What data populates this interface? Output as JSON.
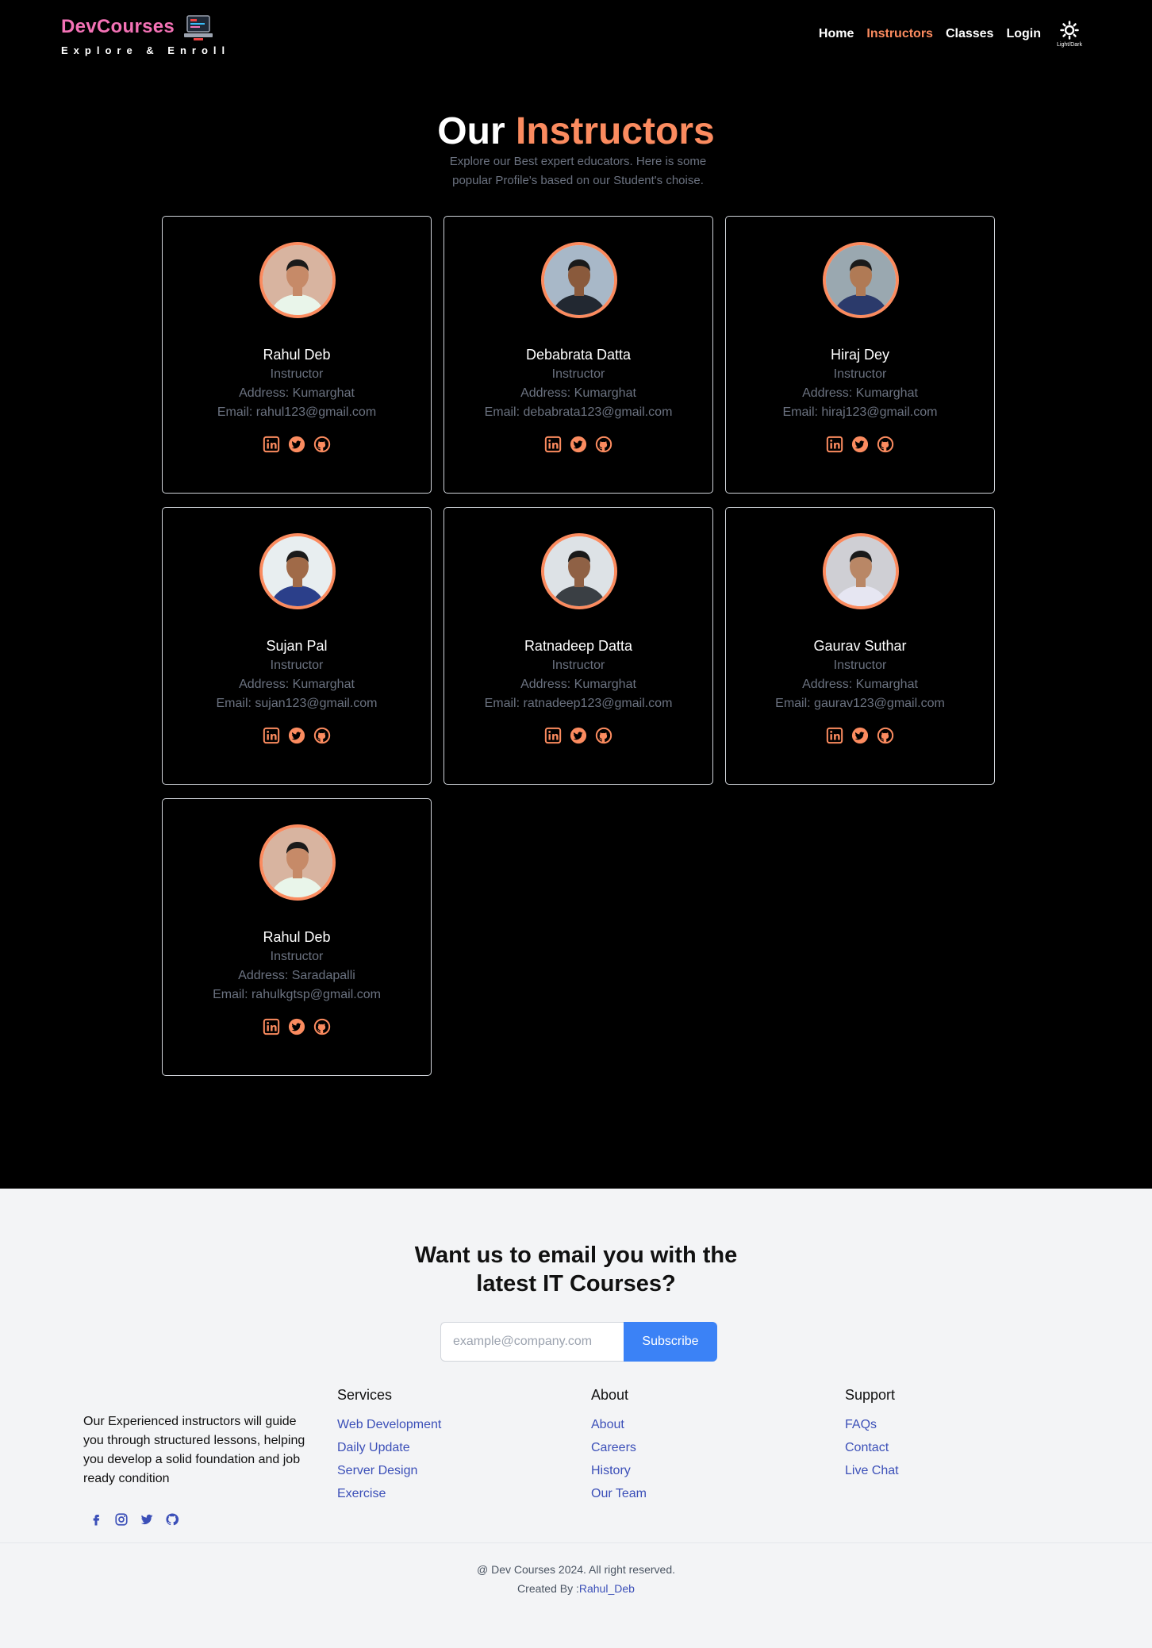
{
  "header": {
    "brand_name": "DevCourses",
    "brand_tagline": "Explore & Enroll",
    "nav": [
      {
        "label": "Home",
        "active": false
      },
      {
        "label": "Instructors",
        "active": true
      },
      {
        "label": "Classes",
        "active": false
      },
      {
        "label": "Login",
        "active": false
      }
    ],
    "theme_toggle_label": "Light/Dark"
  },
  "hero": {
    "title_prefix": "Our",
    "title_accent": "Instructors",
    "subtitle": "Explore our Best expert educators. Here is some popular Profile's based on our Student's choise."
  },
  "instructors": [
    {
      "name": "Rahul Deb",
      "role": "Instructor",
      "address": "Address: Kumarghat",
      "email": "Email: rahul123@gmail.com"
    },
    {
      "name": "Debabrata Datta",
      "role": "Instructor",
      "address": "Address: Kumarghat",
      "email": "Email: debabrata123@gmail.com"
    },
    {
      "name": "Hiraj Dey",
      "role": "Instructor",
      "address": "Address: Kumarghat",
      "email": "Email: hiraj123@gmail.com"
    },
    {
      "name": "Sujan Pal",
      "role": "Instructor",
      "address": "Address: Kumarghat",
      "email": "Email: sujan123@gmail.com"
    },
    {
      "name": "Ratnadeep Datta",
      "role": "Instructor",
      "address": "Address: Kumarghat",
      "email": "Email: ratnadeep123@gmail.com"
    },
    {
      "name": "Gaurav Suthar",
      "role": "Instructor",
      "address": "Address: Kumarghat",
      "email": "Email: gaurav123@gmail.com"
    },
    {
      "name": "Rahul Deb",
      "role": "Instructor",
      "address": "Address: Saradapalli",
      "email": "Email: rahulkgtsp@gmail.com"
    }
  ],
  "social_icons": [
    "linkedin-icon",
    "twitter-icon",
    "github-icon"
  ],
  "footer": {
    "newsletter_line1": "Want us to email you with the",
    "newsletter_line2": "latest IT Courses?",
    "email_placeholder": "example@company.com",
    "subscribe_label": "Subscribe",
    "about_text": "Our Experienced instructors will guide you through structured lessons, helping you develop a solid foundation and job ready condition",
    "social_icons": [
      "facebook-icon",
      "instagram-icon",
      "twitter-icon",
      "github-icon"
    ],
    "columns": [
      {
        "title": "Services",
        "links": [
          "Web Development",
          "Daily Update",
          "Server Design",
          "Exercise"
        ]
      },
      {
        "title": "About",
        "links": [
          "About",
          "Careers",
          "History",
          "Our Team"
        ]
      },
      {
        "title": "Support",
        "links": [
          "FAQs",
          "Contact",
          "Live Chat"
        ]
      }
    ],
    "copyright": "@ Dev Courses 2024. All right reserved.",
    "credit_prefix": "Created By :",
    "credit_name": "Rahul_Deb"
  },
  "colors": {
    "accent": "#fb8b5f",
    "brand_pink": "#f472b6",
    "link_blue": "#3b4fb8",
    "button_blue": "#3b82f6"
  }
}
